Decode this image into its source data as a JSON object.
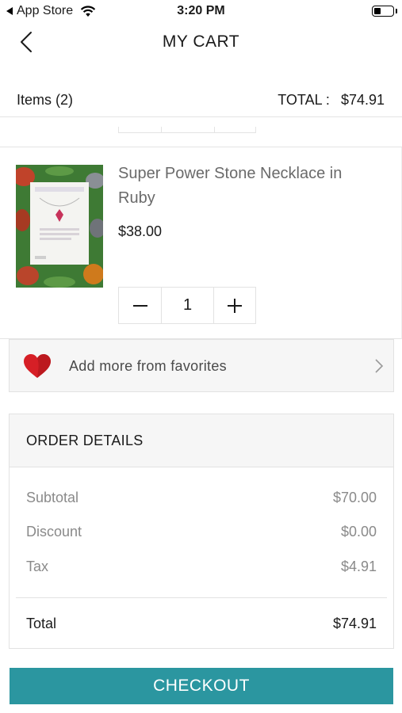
{
  "status_bar": {
    "back_app": "App Store",
    "time": "3:20 PM",
    "battery_level": 0.4
  },
  "nav": {
    "title": "MY CART",
    "back_icon": "chevron-left-icon"
  },
  "summary": {
    "items_label": "Items (2)",
    "total_label": "TOTAL :",
    "total_value": "$74.91"
  },
  "cart_item": {
    "name": "Super Power Stone Necklace in Ruby",
    "price": "$38.00",
    "quantity": "1",
    "minus_icon": "minus-icon",
    "plus_icon": "plus-icon"
  },
  "favorites": {
    "label": "Add more from favorites",
    "icon": "heart-icon",
    "chevron": "chevron-right-icon",
    "heart_color": "#d61f26"
  },
  "order_details": {
    "header": "ORDER DETAILS",
    "rows": [
      {
        "label": "Subtotal",
        "value": "$70.00"
      },
      {
        "label": "Discount",
        "value": "$0.00"
      },
      {
        "label": "Tax",
        "value": "$4.91"
      }
    ],
    "total_label": "Total",
    "total_value": "$74.91"
  },
  "checkout": {
    "label": "CHECKOUT",
    "color": "#2b96a0"
  }
}
